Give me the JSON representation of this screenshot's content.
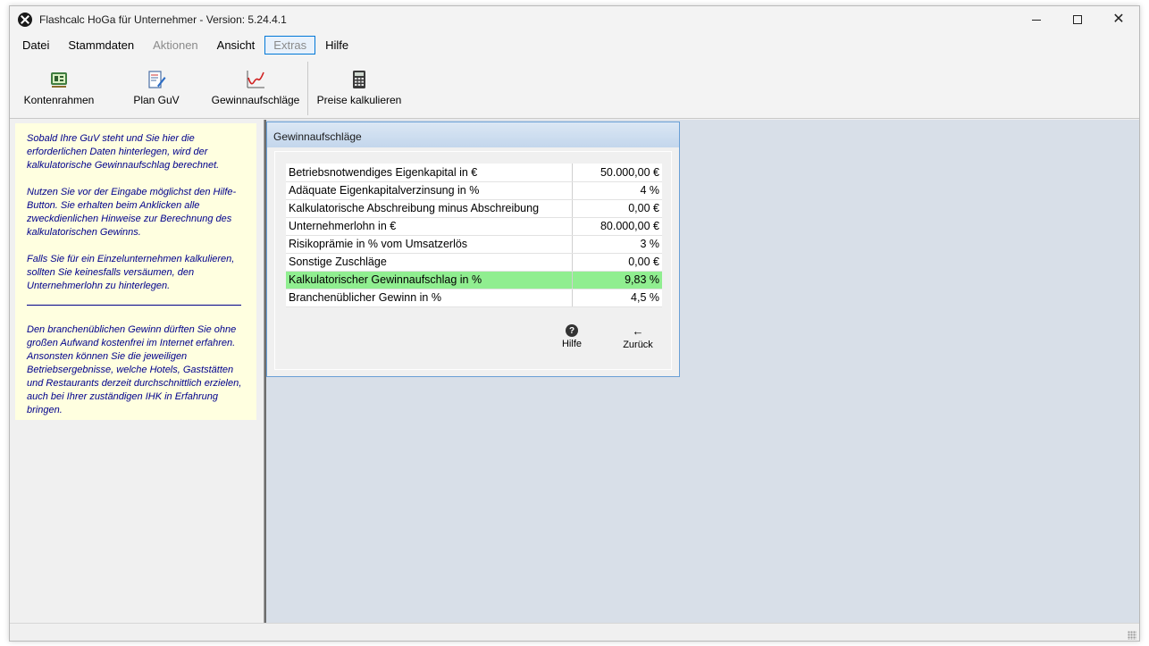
{
  "window": {
    "title": "Flashcalc HoGa für Unternehmer - Version: 5.24.4.1"
  },
  "menu": {
    "items": [
      {
        "label": "Datei",
        "state": "normal"
      },
      {
        "label": "Stammdaten",
        "state": "normal"
      },
      {
        "label": "Aktionen",
        "state": "disabled"
      },
      {
        "label": "Ansicht",
        "state": "normal"
      },
      {
        "label": "Extras",
        "state": "active"
      },
      {
        "label": "Hilfe",
        "state": "normal"
      }
    ]
  },
  "toolbar": {
    "kontenrahmen": "Kontenrahmen",
    "plan_guv": "Plan GuV",
    "gewinnaufschlaege": "Gewinnaufschläge",
    "preise": "Preise kalkulieren"
  },
  "hint": {
    "p1": "Sobald Ihre GuV steht und Sie hier die erforderlichen Daten hinterlegen, wird der kalkulatorische Gewinnaufschlag berechnet.",
    "p2": "Nutzen Sie vor der Eingabe möglichst den Hilfe-Button. Sie erhalten beim Anklicken alle zweckdienlichen Hinweise zur Berechnung des kalkulatorischen Gewinns.",
    "p3": "Falls Sie für ein Einzelunternehmen kalkulieren, sollten Sie keinesfalls versäumen, den Unternehmerlohn zu hinterlegen.",
    "p4": "Den branchenüblichen Gewinn dürften Sie ohne großen Aufwand kostenfrei im Internet erfahren. Ansonsten können Sie die jeweiligen Betriebsergebnisse, welche Hotels, Gaststätten und Restaurants derzeit durchschnittlich erzielen, auch bei Ihrer zuständigen IHK in Erfahrung bringen."
  },
  "dialog": {
    "title": "Gewinnaufschläge",
    "rows": [
      {
        "label": "Betriebsnotwendiges Eigenkapital in €",
        "value": "50.000,00 €"
      },
      {
        "label": "Adäquate Eigenkapitalverzinsung in %",
        "value": "4 %"
      },
      {
        "label": "Kalkulatorische Abschreibung minus Abschreibung",
        "value": "0,00 €"
      },
      {
        "label": "Unternehmerlohn in €",
        "value": "80.000,00 €"
      },
      {
        "label": "Risikoprämie in % vom Umsatzerlös",
        "value": "3 %"
      },
      {
        "label": "Sonstige Zuschläge",
        "value": "0,00 €"
      },
      {
        "label": "Kalkulatorischer Gewinnaufschlag in %",
        "value": "9,83 %"
      },
      {
        "label": "Branchenüblicher Gewinn in %",
        "value": "4,5 %"
      }
    ],
    "highlight_color": "#90ee90",
    "help_label": "Hilfe",
    "back_label": "Zurück"
  }
}
